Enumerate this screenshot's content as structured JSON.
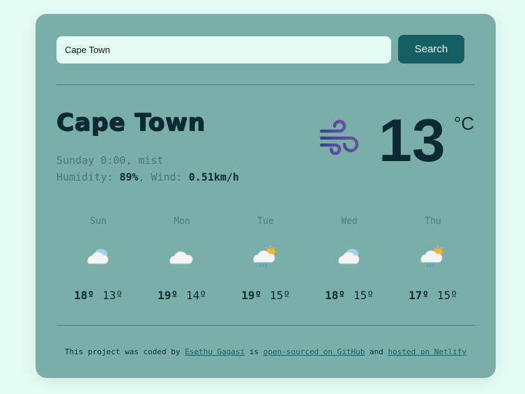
{
  "search": {
    "value": "Cape Town",
    "button_label": "Search"
  },
  "current": {
    "city": "Cape Town",
    "datetime_condition": "Sunday 0:00, mist",
    "humidity_label": "Humidity: ",
    "humidity_value": "89%",
    "wind_label": ", Wind: ",
    "wind_value": "0.51km/h",
    "temperature": "13",
    "unit": "°C",
    "icon": "wind-icon"
  },
  "forecast": [
    {
      "day": "Sun",
      "max": "18º",
      "min": "13º",
      "icon": "cloud-sun-icon"
    },
    {
      "day": "Mon",
      "max": "19º",
      "min": "14º",
      "icon": "cloud-icon"
    },
    {
      "day": "Tue",
      "max": "19º",
      "min": "15º",
      "icon": "sun-rain-icon"
    },
    {
      "day": "Wed",
      "max": "18º",
      "min": "15º",
      "icon": "cloud-sun-icon"
    },
    {
      "day": "Thu",
      "max": "17º",
      "min": "15º",
      "icon": "sun-rain-icon"
    }
  ],
  "footer": {
    "text1": "This project was coded by ",
    "author_link": "Esethu Gagasi",
    "text2": " is ",
    "github_link": "open-sourced on GitHub",
    "text3": " and ",
    "netlify_link": "hosted on Netlify"
  },
  "colors": {
    "page_background": "#e3fbf3",
    "card_background": "#7aafa9",
    "accent": "#155e63",
    "text_dark": "#0d2a32"
  }
}
